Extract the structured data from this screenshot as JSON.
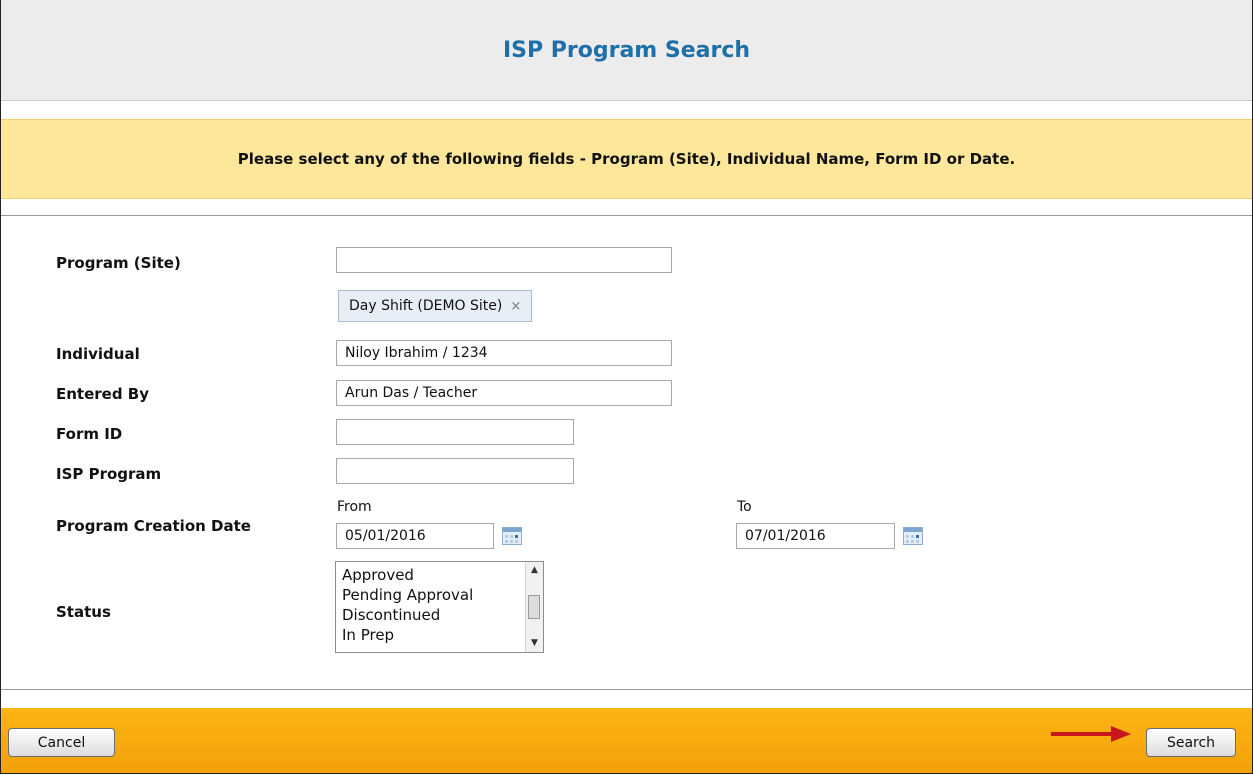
{
  "header": {
    "title": "ISP Program Search"
  },
  "notice": {
    "text": "Please select any of the following fields - Program (Site), Individual Name, Form ID or Date."
  },
  "form": {
    "program_site": {
      "label": "Program (Site)",
      "value": "",
      "selected_chip": "Day Shift (DEMO Site)",
      "chip_remove": "×"
    },
    "individual": {
      "label": "Individual",
      "value": "Niloy Ibrahim / 1234"
    },
    "entered_by": {
      "label": "Entered By",
      "value": "Arun Das / Teacher"
    },
    "form_id": {
      "label": "Form ID",
      "value": ""
    },
    "isp_program": {
      "label": "ISP Program",
      "value": ""
    },
    "creation_date": {
      "label": "Program Creation Date",
      "from_label": "From",
      "from_value": "05/01/2016",
      "to_label": "To",
      "to_value": "07/01/2016"
    },
    "status": {
      "label": "Status",
      "options": [
        "Approved",
        "Pending Approval",
        "Discontinued",
        "In Prep"
      ]
    }
  },
  "footer": {
    "cancel_label": "Cancel",
    "search_label": "Search"
  },
  "icons": {
    "calendar": "calendar-icon",
    "remove": "close-icon",
    "arrow": "arrow-right-icon",
    "scroll_up": "chevron-up-icon",
    "scroll_down": "chevron-down-icon"
  },
  "colors": {
    "title": "#1f6fa8",
    "notice_bg": "#fde79a",
    "footer_bg": "#fdb414",
    "arrow": "#c8161d"
  }
}
